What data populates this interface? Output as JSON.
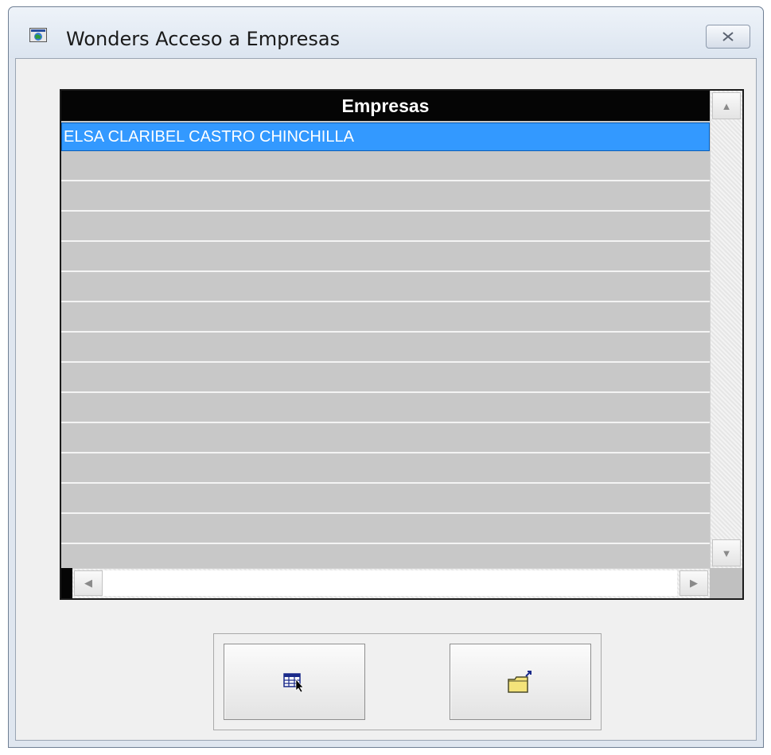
{
  "window": {
    "title": "Wonders Acceso a Empresas",
    "app_icon": "app-globe-icon",
    "close_icon": "close-icon"
  },
  "grid": {
    "column_header": "Empresas",
    "rows": [
      "ELSA CLARIBEL CASTRO CHINCHILLA"
    ],
    "empty_row_count": 13,
    "selected_row_index": 0
  },
  "scrollbars": {
    "up_icon": "arrow-up-icon",
    "down_icon": "arrow-down-icon",
    "left_icon": "arrow-left-icon",
    "right_icon": "arrow-right-icon"
  },
  "buttons": [
    {
      "icon": "select-table-icon"
    },
    {
      "icon": "open-folder-exit-icon"
    }
  ],
  "colors": {
    "selection": "#3399ff",
    "header_bg": "#050505",
    "grid_bg": "#c8c8c8"
  }
}
